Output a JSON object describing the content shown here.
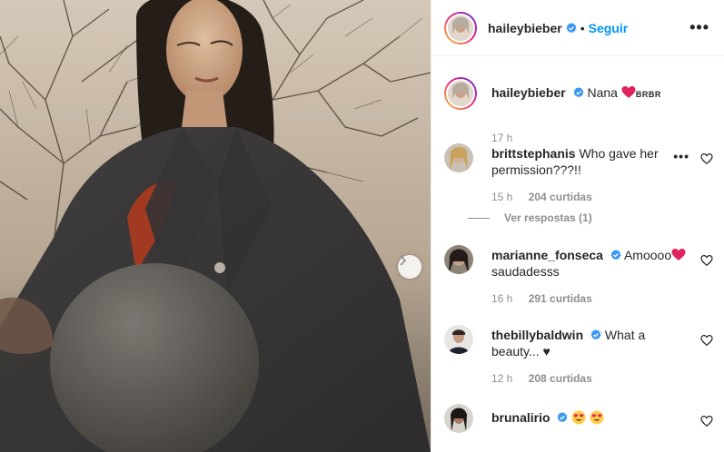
{
  "header": {
    "username": "haileybieber",
    "follow_label": "Seguir",
    "separator": "•",
    "more_label": "•••"
  },
  "caption": {
    "username": "haileybieber",
    "text": "Nana",
    "tag": "BRBR",
    "time": "17 h"
  },
  "comments": [
    {
      "username": "brittstephanis",
      "text": "Who gave her permission???!!",
      "time": "15 h",
      "likes": "204 curtidas",
      "replies": "Ver respostas (1)",
      "more_label": "•••"
    },
    {
      "username": "marianne_fonseca",
      "text": "Amoooo",
      "text2": "saudadesss",
      "time": "16 h",
      "likes": "291 curtidas"
    },
    {
      "username": "thebillybaldwin",
      "text": "What a beauty... ♥",
      "time": "12 h",
      "likes": "208 curtidas"
    },
    {
      "username": "brunalirio",
      "text": ""
    }
  ],
  "icons": {
    "verified": "verified-badge-icon",
    "heart": "heart-outline-icon",
    "next": "chevron-right-icon"
  },
  "colors": {
    "link_blue": "#0095f6",
    "verified_blue": "#3897f0",
    "muted": "#8e8e8e",
    "red_heart": "#e0245e"
  }
}
